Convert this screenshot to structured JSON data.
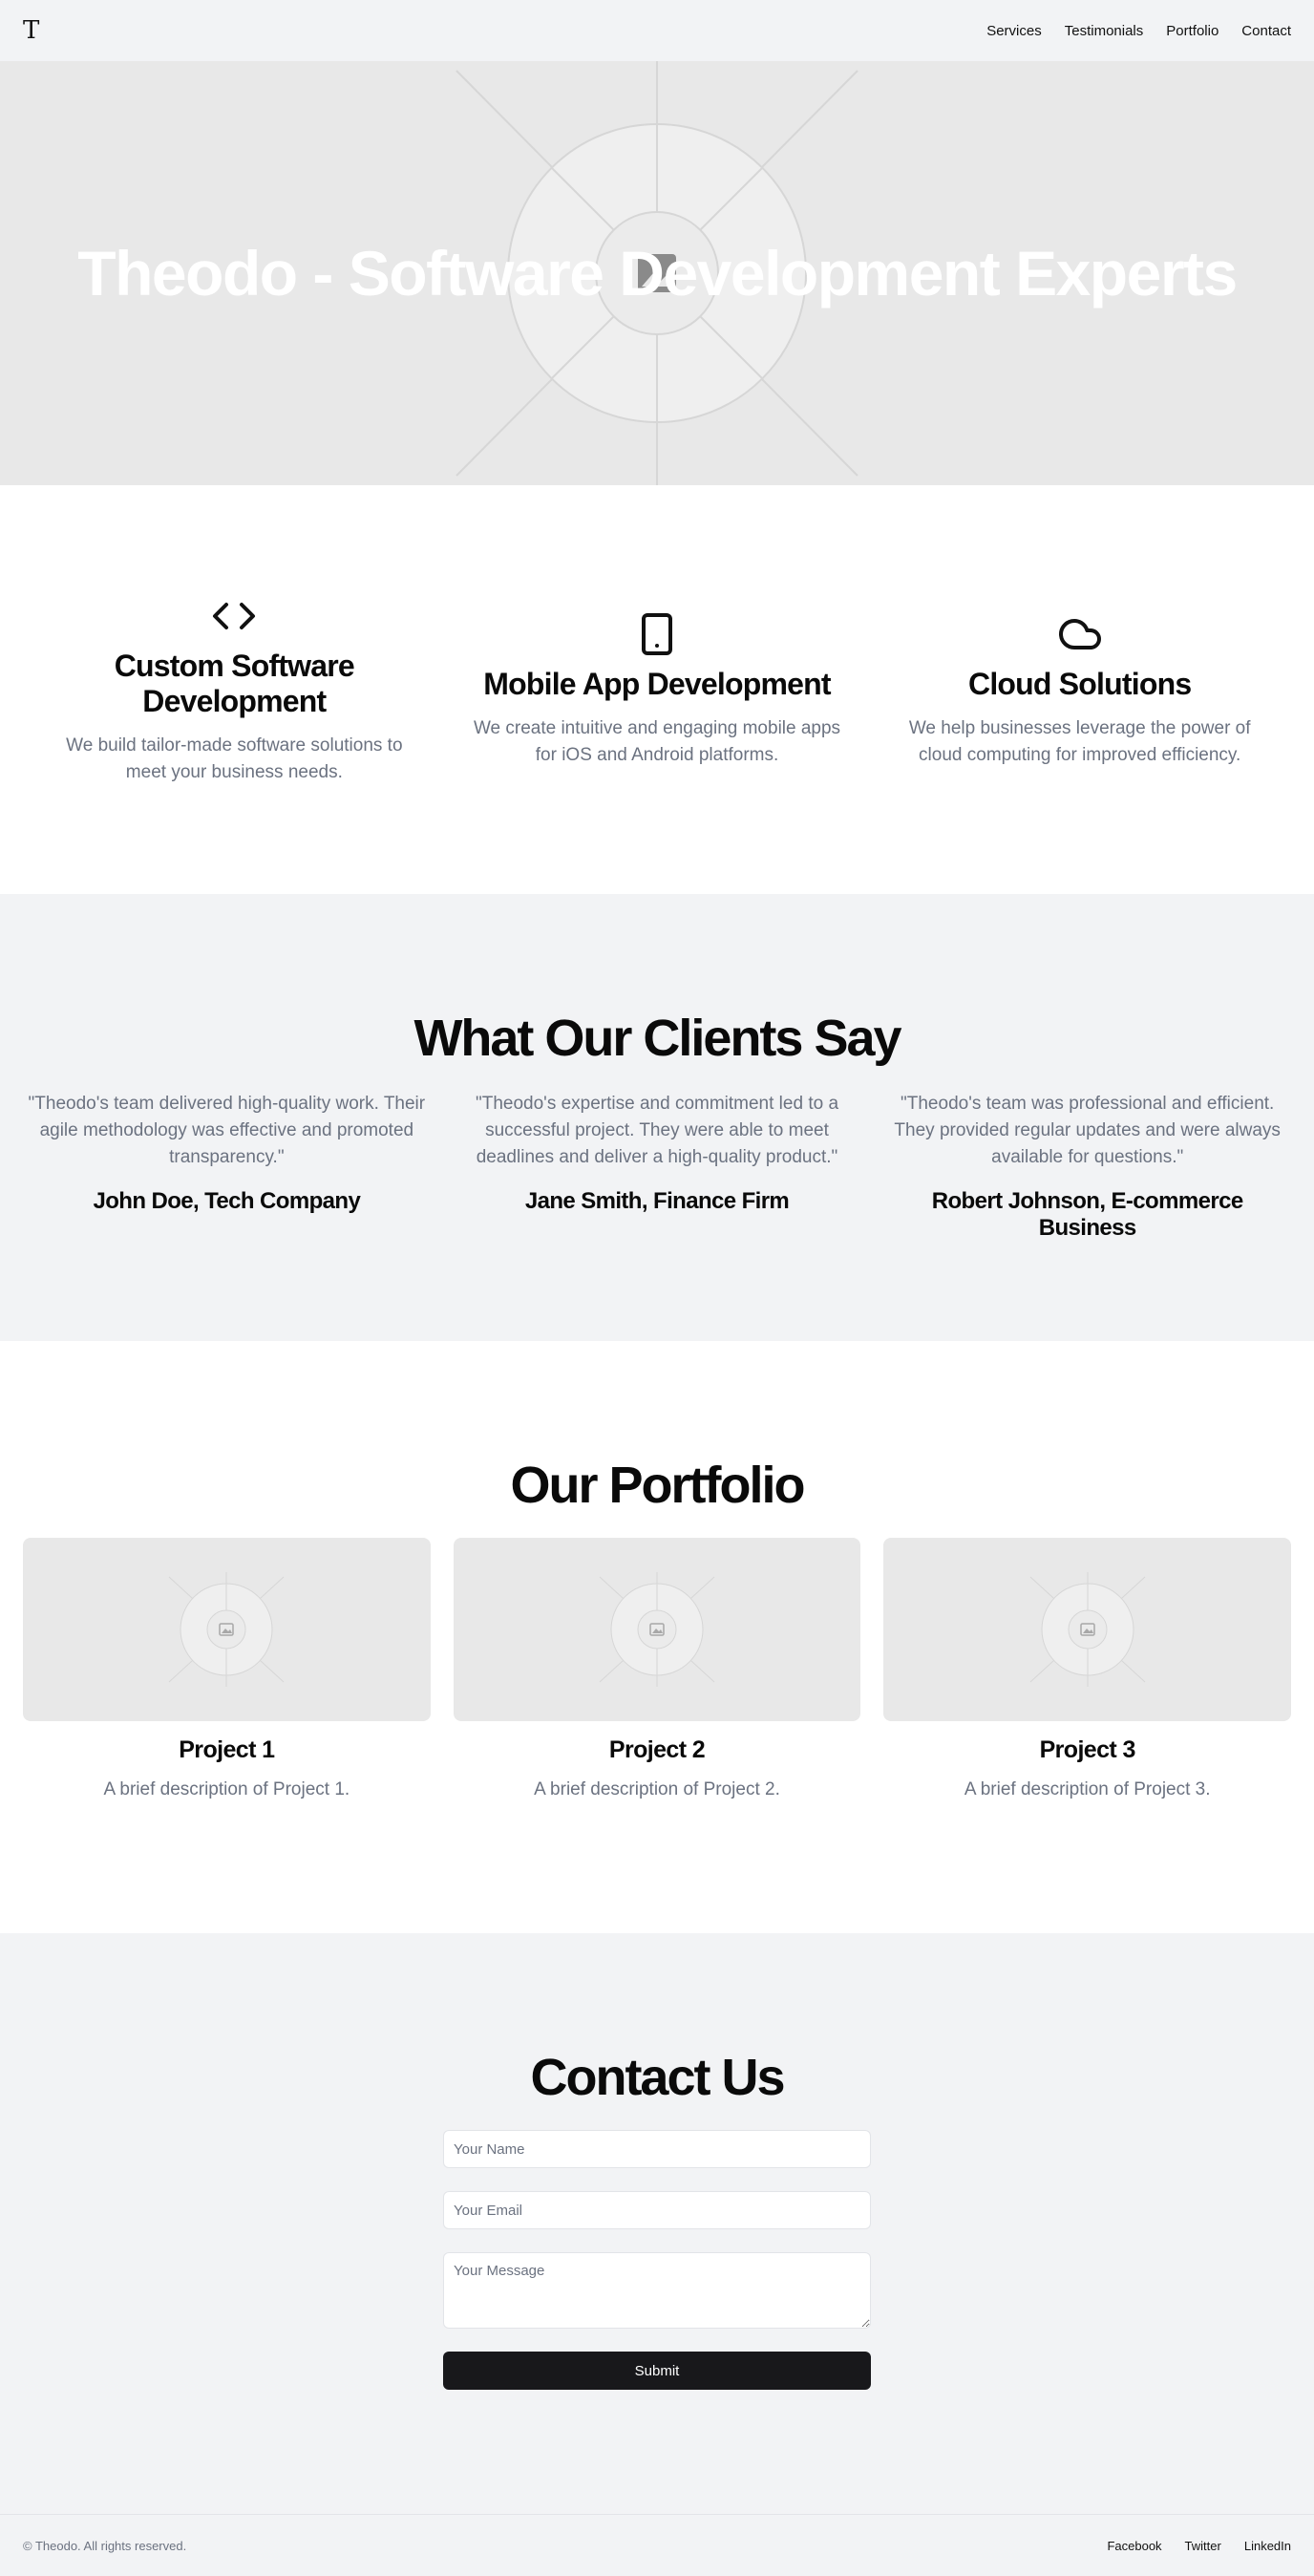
{
  "header": {
    "logo": "T",
    "nav": [
      "Services",
      "Testimonials",
      "Portfolio",
      "Contact"
    ]
  },
  "hero": {
    "title": "Theodo - Software Development Experts"
  },
  "services": [
    {
      "icon": "code-icon",
      "title": "Custom Software Development",
      "description": "We build tailor-made software solutions to meet your business needs."
    },
    {
      "icon": "smartphone-icon",
      "title": "Mobile App Development",
      "description": "We create intuitive and engaging mobile apps for iOS and Android platforms."
    },
    {
      "icon": "cloud-icon",
      "title": "Cloud Solutions",
      "description": "We help businesses leverage the power of cloud computing for improved efficiency."
    }
  ],
  "testimonials": {
    "title": "What Our Clients Say",
    "items": [
      {
        "quote": "\"Theodo's team delivered high-quality work. Their agile methodology was effective and promoted transparency.\"",
        "author": "John Doe, Tech Company"
      },
      {
        "quote": "\"Theodo's expertise and commitment led to a successful project. They were able to meet deadlines and deliver a high-quality product.\"",
        "author": "Jane Smith, Finance Firm"
      },
      {
        "quote": "\"Theodo's team was professional and efficient. They provided regular updates and were always available for questions.\"",
        "author": "Robert Johnson, E-commerce Business"
      }
    ]
  },
  "portfolio": {
    "title": "Our Portfolio",
    "items": [
      {
        "title": "Project 1",
        "description": "A brief description of Project 1."
      },
      {
        "title": "Project 2",
        "description": "A brief description of Project 2."
      },
      {
        "title": "Project 3",
        "description": "A brief description of Project 3."
      }
    ]
  },
  "contact": {
    "title": "Contact Us",
    "name_placeholder": "Your Name",
    "email_placeholder": "Your Email",
    "message_placeholder": "Your Message",
    "submit_label": "Submit"
  },
  "footer": {
    "copyright": "© Theodo. All rights reserved.",
    "links": [
      "Facebook",
      "Twitter",
      "LinkedIn"
    ]
  }
}
